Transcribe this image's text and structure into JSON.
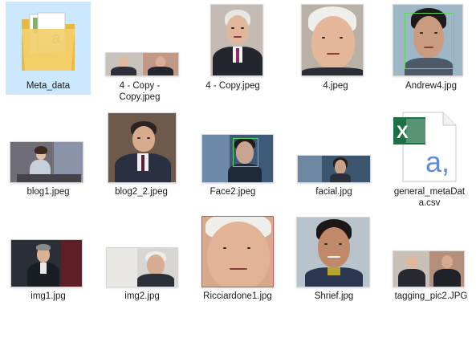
{
  "files": [
    {
      "name": "Meta_data",
      "icon": "folder-icon"
    },
    {
      "name": "4 - Copy - Copy.jpeg",
      "icon": "image-thumbnail"
    },
    {
      "name": "4 - Copy.jpeg",
      "icon": "image-thumbnail"
    },
    {
      "name": "4.jpeg",
      "icon": "image-thumbnail"
    },
    {
      "name": "Andrew4.jpg",
      "icon": "image-thumbnail"
    },
    {
      "name": "blog1.jpeg",
      "icon": "image-thumbnail"
    },
    {
      "name": "blog2_2.jpeg",
      "icon": "image-thumbnail"
    },
    {
      "name": "Face2.jpeg",
      "icon": "image-thumbnail"
    },
    {
      "name": "facial.jpg",
      "icon": "image-thumbnail"
    },
    {
      "name": "general_metaData.csv",
      "icon": "excel-csv-icon"
    },
    {
      "name": "img1.jpg",
      "icon": "image-thumbnail"
    },
    {
      "name": "img2.jpg",
      "icon": "image-thumbnail"
    },
    {
      "name": "Ricciardone1.jpg",
      "icon": "image-thumbnail"
    },
    {
      "name": "Shrief.jpg",
      "icon": "image-thumbnail"
    },
    {
      "name": "tagging_pic2.JPG",
      "icon": "image-thumbnail"
    }
  ],
  "labels": {
    "f1_line1": "4 - Copy -",
    "f1_line2": "Copy.jpeg",
    "f9_line1": "general_metaDat",
    "f9_line2": "a.csv"
  },
  "colors": {
    "selection": "#cce8ff",
    "folder": "#f3cf6b",
    "excel_green": "#1e7145",
    "face_scan_green": "#5fd35f"
  }
}
